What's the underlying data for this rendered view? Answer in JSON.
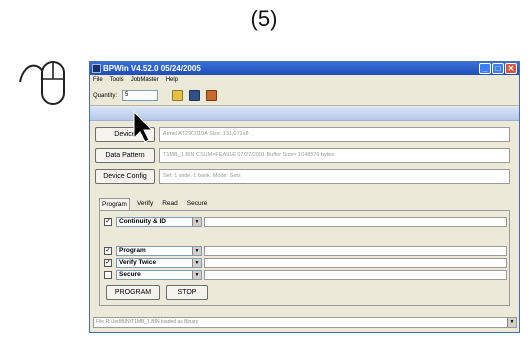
{
  "step": "(5)",
  "window": {
    "title": "BPWin  V4.52.0  05/24/2005",
    "controls": {
      "minimize": "_",
      "maximize": "□",
      "close": "✕"
    }
  },
  "menu": [
    "File",
    "Tools",
    "JobMaster",
    "Help"
  ],
  "toolbar": {
    "quantity_label": "Quantity:",
    "quantity_value": "5"
  },
  "device_rows": [
    {
      "button": "Device",
      "info": "Atmel AT29C010A   Size: 131,072x8"
    },
    {
      "button": "Data Pattern",
      "info": "T1MB_1.BIN   CSUM=FEA91E   07/27/2001   Buffer Size= 1048576 bytes"
    },
    {
      "button": "Device Config",
      "info": "Set: 1 wide, 1 bank.  Mode: Sets"
    }
  ],
  "tabs": [
    "Program",
    "Verify",
    "Read",
    "Secure"
  ],
  "operations": [
    {
      "checked": true,
      "label": "Continuity & ID"
    },
    {
      "checked": true,
      "label": "Program"
    },
    {
      "checked": true,
      "label": "Verify Twice"
    },
    {
      "checked": false,
      "label": "Secure"
    }
  ],
  "actions": {
    "program": "PROGRAM",
    "stop": "STOP"
  },
  "status": "File R:\\Jed\\BIN\\T1MB_1.BIN loaded as Binary"
}
